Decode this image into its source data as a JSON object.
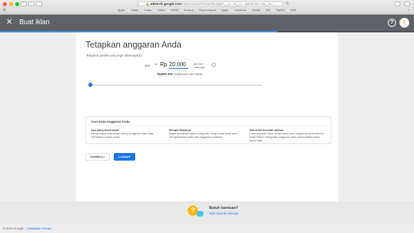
{
  "browser": {
    "url_host": "adwords.google.com",
    "url_path": "/express/plus/#/wizard/budget?__u=...&__c=...&authuser=0&__lu=...",
    "bookmarks": [
      "Apple",
      "Twitter",
      "Twitter",
      "Yahoo",
      "ESPN",
      "Reuters",
      "Psychological",
      "Apple",
      "Facebook",
      "Tumblr",
      "BDI",
      "PayPal",
      "MSN"
    ],
    "colors": {
      "close": "#ff5f57",
      "minimize": "#febc2e",
      "zoom": "#28c840"
    }
  },
  "appbar": {
    "close_icon": "close-icon",
    "title": "Buat iklan",
    "help_icon": "?",
    "account_initial": "I",
    "progress_fraction": 0.67,
    "color": "#5f6368",
    "progress_color": "#4285f4"
  },
  "main": {
    "heading": "Tetapkan anggaran Anda",
    "subtext": "Tetapkan jumlah yang ingin dibelanjakan.",
    "budget": {
      "currency_code": "IDR",
      "equals": "=",
      "currency_symbol": "Rp",
      "amount": "20.000",
      "per_day": "per hari rata-rata",
      "info_icon": "i"
    },
    "monthly": {
      "amount": "Rp600.000",
      "suffix": "maksimum per bulan"
    },
    "slider": {
      "value_fraction": 0.0,
      "accent": "#1a73e8"
    }
  },
  "how_it_works": {
    "title": "Cara kerja anggaran Anda",
    "columns": [
      {
        "title": "Apa yang Anda bayar",
        "text": "Hanya bayar bila orang-orang mengeklik iklan atau menelepon bisnis Anda."
      },
      {
        "title": "Berapa biayanya",
        "text": "Biaya bervariasi untuk setiap klik, tetapi Anda tidak akan menghabiskan lebih dari anggaran bulanan."
      },
      {
        "title": "Jika Anda berubah pikiran",
        "text": "Coba jalankan iklan, tetapi tidak perlu langsung berkomitmen. Anda bebas mengubah anggaran atau membatalkan iklan kapan saja."
      }
    ]
  },
  "buttons": {
    "back": "KEMBALI",
    "next": "LANJUT",
    "next_color": "#1a73e8"
  },
  "help": {
    "title": "Butuh bantuan?",
    "link": "Opsi bantuan lainnya"
  },
  "footer": {
    "copyright": "© 2019 Google",
    "divider": "|",
    "privacy": "Kebijakan Privasi"
  }
}
